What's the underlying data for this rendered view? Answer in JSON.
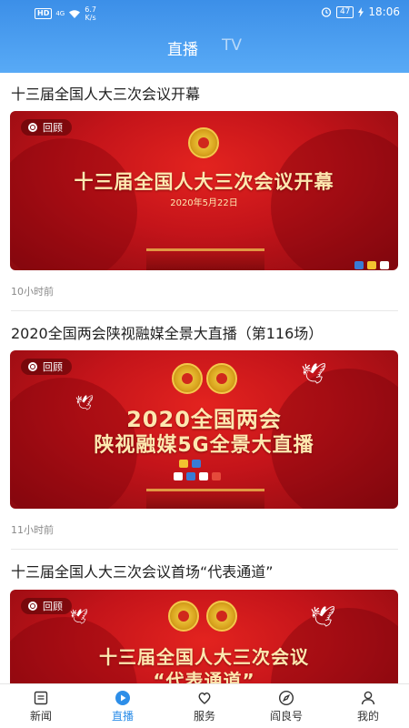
{
  "status_bar": {
    "hd": "HD",
    "signal": "4G",
    "speed_value": "6.7",
    "speed_unit": "K/s",
    "battery": "47",
    "time": "18:06"
  },
  "header": {
    "tabs": [
      {
        "label": "直播",
        "active": true
      },
      {
        "label": "TV",
        "active": false
      }
    ]
  },
  "feed": {
    "items": [
      {
        "title": "十三届全国人大三次会议开幕",
        "badge": "回顾",
        "thumb_line1": "十三届全国人大三次会议开幕",
        "thumb_date": "2020年5月22日",
        "time": "10小时前"
      },
      {
        "title": "2020全国两会陕视融媒全景大直播（第116场）",
        "badge": "回顾",
        "thumb_line1": "2020全国两会",
        "thumb_line2": "陕视融媒5G全景大直播",
        "time": "11小时前"
      },
      {
        "title": "十三届全国人大三次会议首场“代表通道”",
        "badge": "回顾",
        "thumb_line1": "十三届全国人大三次会议",
        "thumb_line2": "“代表通道”"
      }
    ]
  },
  "bottom_nav": {
    "items": [
      {
        "label": "新闻",
        "icon": "news-icon",
        "active": false
      },
      {
        "label": "直播",
        "icon": "play-icon",
        "active": true
      },
      {
        "label": "服务",
        "icon": "service-icon",
        "active": false
      },
      {
        "label": "阎良号",
        "icon": "compass-icon",
        "active": false
      },
      {
        "label": "我的",
        "icon": "user-icon",
        "active": false
      }
    ]
  },
  "colors": {
    "accent": "#2d8ee8",
    "header_top": "#3c8fe8",
    "header_bottom": "#58aaf6",
    "banner_red": "#c4141a",
    "banner_text": "#fde8b0"
  }
}
